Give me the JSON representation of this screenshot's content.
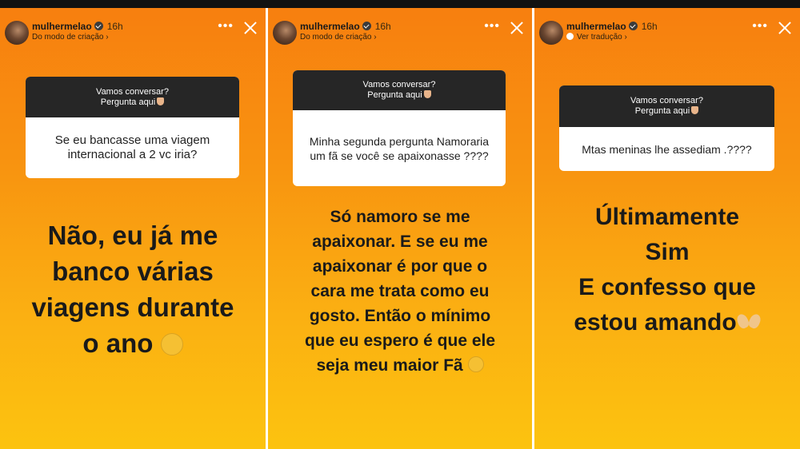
{
  "stories": [
    {
      "user": "mulhermelao",
      "time": "16h",
      "subtitle": "Do modo de criação",
      "question_header": "Vamos conversar?",
      "question_sub": "Pergunta aqui",
      "question": "Se eu bancasse uma viagem internacional a 2 vc iria?",
      "answer_lines": [
        "Não, eu já me",
        "banco várias",
        "viagens durante",
        "o ano"
      ]
    },
    {
      "user": "mulhermelao",
      "time": "16h",
      "subtitle": "Do modo de criação",
      "question_header": "Vamos conversar?",
      "question_sub": "Pergunta aqui",
      "question": "Minha segunda pergunta Namoraria um fã se você se apaixonasse ????",
      "answer_lines": [
        "Só namoro se me",
        "apaixonar. E se eu me",
        "apaixonar é por que o",
        "cara me trata como eu",
        "gosto. Então o mínimo",
        "que eu espero é que ele",
        "seja meu maior Fã"
      ]
    },
    {
      "user": "mulhermelao",
      "time": "16h",
      "subtitle": "Ver tradução",
      "question_header": "Vamos conversar?",
      "question_sub": "Pergunta aqui",
      "question": "Mtas meninas lhe assediam .????",
      "answer_lines": [
        "Últimamente",
        "Sim",
        "E confesso que",
        "estou amando"
      ]
    }
  ],
  "icons": {
    "more": "more-dots-icon",
    "close": "close-icon",
    "verified": "verified-badge-icon"
  },
  "colors": {
    "gradient_top": "#f77f0f",
    "gradient_bottom": "#fcc30f",
    "question_header": "#262626"
  }
}
